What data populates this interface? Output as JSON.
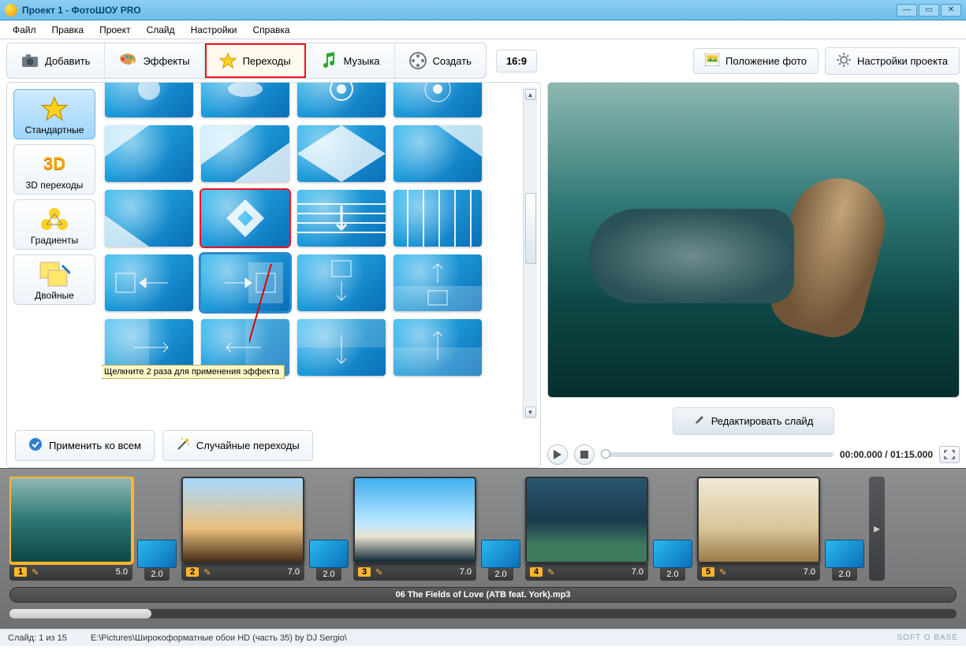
{
  "titlebar": {
    "title": "Проект 1 - ФотоШОУ PRO"
  },
  "menu": {
    "file": "Файл",
    "edit": "Правка",
    "project": "Проект",
    "slide": "Слайд",
    "settings": "Настройки",
    "help": "Справка"
  },
  "toolbar": {
    "add": "Добавить",
    "effects": "Эффекты",
    "transitions": "Переходы",
    "music": "Музыка",
    "create": "Создать",
    "aspect": "16:9",
    "photo_pos": "Положение фото",
    "proj_settings": "Настройки проекта"
  },
  "categories": {
    "standard": "Стандартные",
    "three_d": "3D переходы",
    "gradients": "Градиенты",
    "double": "Двойные"
  },
  "tooltip": "Щелкните 2 раза для применения эффекта",
  "bottom_buttons": {
    "apply_all": "Применить ко всем",
    "random": "Случайные переходы"
  },
  "preview": {
    "edit_slide": "Редактировать слайд",
    "time": "00:00.000 / 01:15.000"
  },
  "timeline": {
    "slides": [
      {
        "num": "1",
        "dur": "5.0"
      },
      {
        "num": "2",
        "dur": "7.0"
      },
      {
        "num": "3",
        "dur": "7.0"
      },
      {
        "num": "4",
        "dur": "7.0"
      },
      {
        "num": "5",
        "dur": "7.0"
      }
    ],
    "trans_dur": "2.0",
    "audio": "06 The Fields of Love (ATB feat. York).mp3"
  },
  "status": {
    "slide": "Слайд: 1 из 15",
    "path": "E:\\Pictures\\Широкоформатные обои HD (часть 35) by DJ Sergio\\",
    "brand": "SOFT O BASE"
  }
}
